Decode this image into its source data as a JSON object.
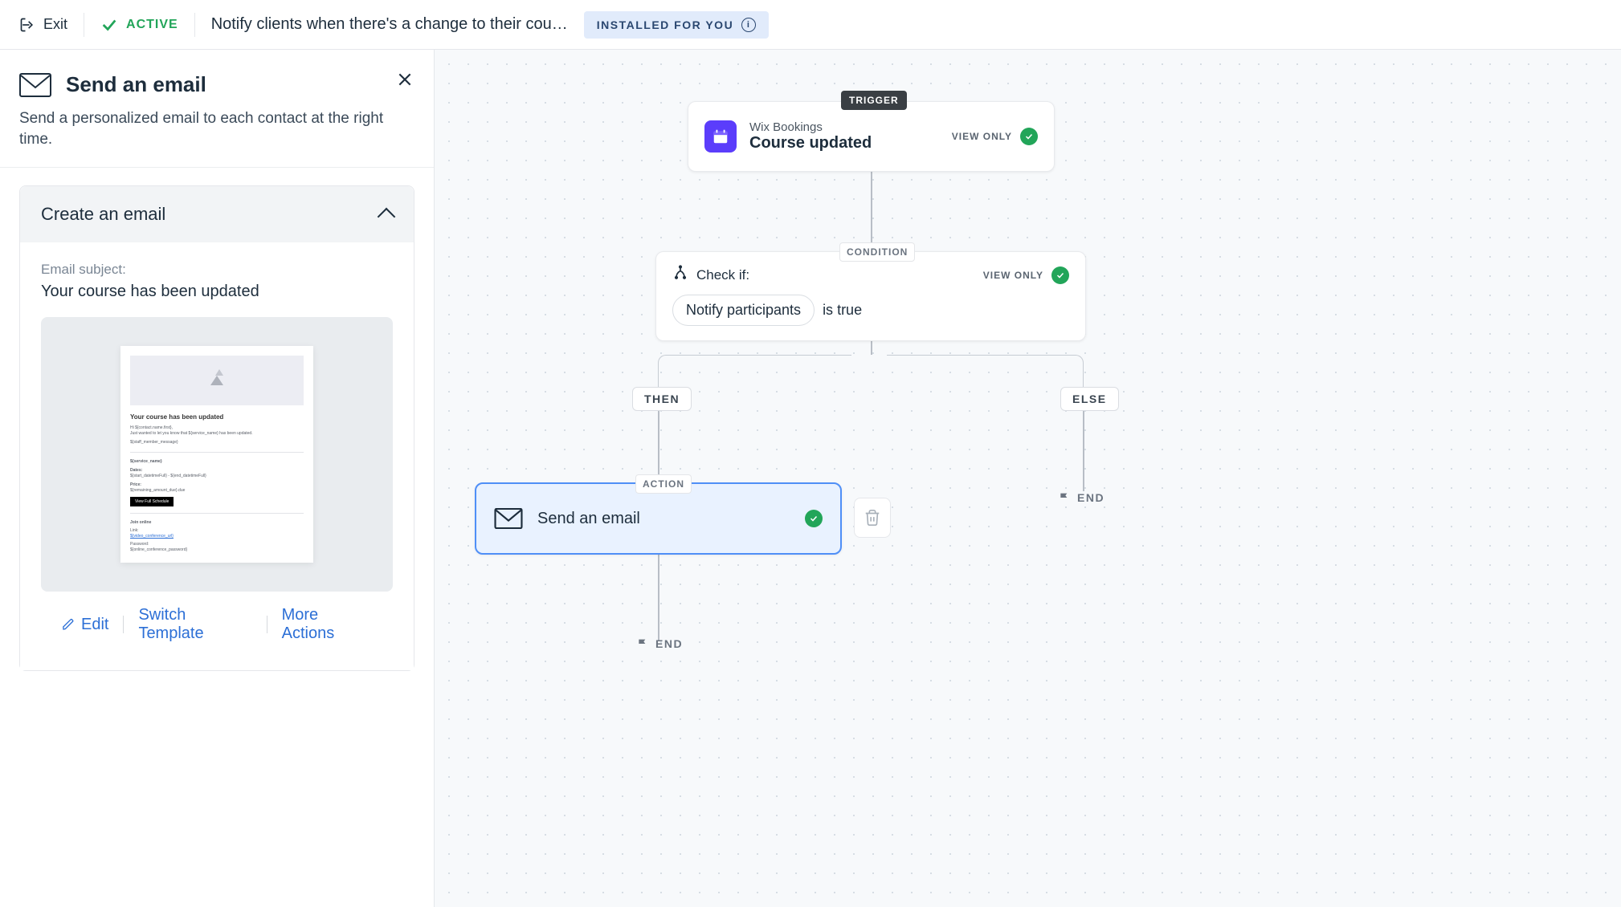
{
  "topbar": {
    "exit": "Exit",
    "status": "ACTIVE",
    "title": "Notify clients when there's a change to their cou…",
    "installed": "INSTALLED FOR YOU"
  },
  "panel": {
    "title": "Send an email",
    "subtitle": "Send a personalized email to each contact at the right time.",
    "accordion_title": "Create an email",
    "subject_label": "Email subject:",
    "subject_value": "Your course has been updated",
    "actions": {
      "edit": "Edit",
      "switch": "Switch Template",
      "more": "More Actions"
    },
    "preview": {
      "heading": "Your course has been updated",
      "greeting": "Hi ${contact.name.first},",
      "body_line": "Just wanted to let you know that ${service_name} has been updated.",
      "staff_msg": "${staff_member_message}",
      "service": "${service_name}",
      "dates_label": "Dates:",
      "dates_val": "${start_datetimeFull} - ${end_datetimeFull}",
      "price_label": "Price:",
      "price_val": "${remaining_amount_due}.due",
      "cta": "View Full Schedule",
      "join_label": "Join online",
      "link_label": "Link:",
      "link_val": "${video_conference_url}",
      "pw_label": "Password:",
      "pw_val": "${online_conference_password}"
    }
  },
  "flow": {
    "badges": {
      "trigger": "TRIGGER",
      "condition": "CONDITION",
      "action": "ACTION",
      "then": "THEN",
      "else": "ELSE",
      "end": "END",
      "view_only": "VIEW ONLY"
    },
    "trigger": {
      "app": "Wix Bookings",
      "event": "Course updated"
    },
    "condition": {
      "check_if": "Check if:",
      "variable": "Notify participants",
      "operator": "is true"
    },
    "action": {
      "title": "Send an email"
    }
  }
}
